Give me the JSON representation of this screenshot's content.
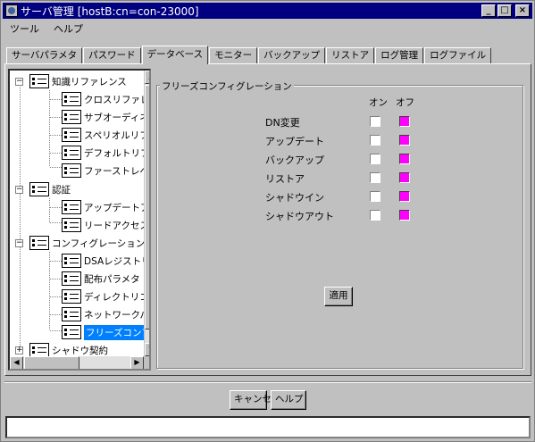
{
  "window": {
    "title": "サーバ管理 [hostB:cn=con-23000]",
    "minimize": "_",
    "maximize": "□",
    "close": "×"
  },
  "menu": {
    "items": [
      "ツール",
      "ヘルプ"
    ]
  },
  "tabs": [
    "サーバパラメタ",
    "パスワード",
    "データベース",
    "モニター",
    "バックアップ",
    "リストア",
    "ログ管理",
    "ログファイル"
  ],
  "active_tab": "データベース",
  "tree": {
    "nodes": [
      {
        "label": "知識リファレンス",
        "level": 0,
        "expander": "−"
      },
      {
        "label": "クロスリファレンス",
        "level": 1
      },
      {
        "label": "サブオーディネート",
        "level": 1
      },
      {
        "label": "スペリオルリファレンス",
        "level": 1
      },
      {
        "label": "デフォルトリフェラル",
        "level": 1
      },
      {
        "label": "ファーストレベルDSA",
        "level": 1
      },
      {
        "label": "認証",
        "level": 0,
        "expander": "−"
      },
      {
        "label": "アップデートアクセス",
        "level": 1
      },
      {
        "label": "リードアクセス制御",
        "level": 1
      },
      {
        "label": "コンフィグレーション",
        "level": 0,
        "expander": "−"
      },
      {
        "label": "DSAレジストリ",
        "level": 1
      },
      {
        "label": "配布パラメタ",
        "level": 1
      },
      {
        "label": "ディレクトリコンフィグ",
        "level": 1
      },
      {
        "label": "ネットワークパラメタ",
        "level": 1
      },
      {
        "label": "フリーズコンフィグ",
        "level": 1,
        "selected": true
      },
      {
        "label": "シャドウ契約",
        "level": 0,
        "expander": "+"
      }
    ]
  },
  "panel": {
    "group_title": "フリーズコンフィグレーション",
    "col_on": "オン",
    "col_off": "オフ",
    "options": [
      {
        "label": "DN変更",
        "on": false,
        "off": true
      },
      {
        "label": "アップデート",
        "on": false,
        "off": true
      },
      {
        "label": "バックアップ",
        "on": false,
        "off": true
      },
      {
        "label": "リストア",
        "on": false,
        "off": true
      },
      {
        "label": "シャドウイン",
        "on": false,
        "off": true
      },
      {
        "label": "シャドウアウト",
        "on": false,
        "off": true
      }
    ],
    "apply_label": "適用"
  },
  "footer": {
    "cancel_label": "キャンセル",
    "help_label": "ヘルプ",
    "status_text": ""
  },
  "colors": {
    "title_bg": "#000080",
    "selected": "#0080ff",
    "checked": "#ff00ff"
  }
}
